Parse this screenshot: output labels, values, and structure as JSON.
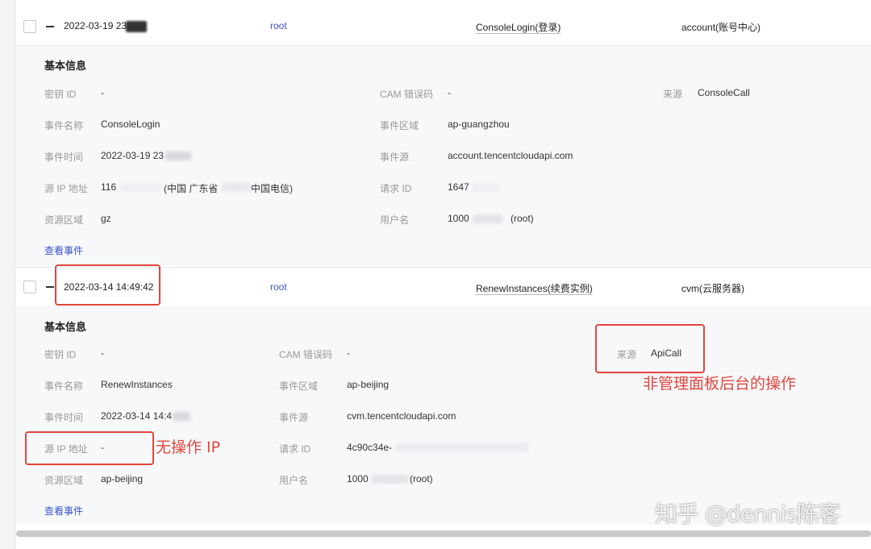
{
  "colors": {
    "link": "#3b55c8",
    "annotation": "#e0463d"
  },
  "events": [
    {
      "time": "2022-03-19 23",
      "user": "root",
      "event_name": "ConsoleLogin(登录)",
      "service": "account(账号中心)",
      "detail": {
        "title": "基本信息",
        "secret_id_label": "密钥 ID",
        "secret_id": "-",
        "cam_label": "CAM 错误码",
        "cam": "-",
        "source_label": "来源",
        "source": "ConsoleCall",
        "name_label": "事件名称",
        "name": "ConsoleLogin",
        "region_label": "事件区域",
        "region": "ap-guangzhou",
        "time_label": "事件时间",
        "time": "2022-03-19 23",
        "event_source_label": "事件源",
        "event_source": "account.tencentcloudapi.com",
        "ip_label": "源 IP 地址",
        "ip": "116",
        "ip_geo_a": "(中国 广东省",
        "ip_geo_b": "中国电信)",
        "request_label": "请求 ID",
        "request": "1647",
        "res_region_label": "资源区域",
        "res_region": "gz",
        "username_label": "用户名",
        "username": "1000",
        "username_suffix": "(root)",
        "view_link": "查看事件"
      }
    },
    {
      "time": "2022-03-14 14:49:42",
      "user": "root",
      "event_name": "RenewInstances(续费实例)",
      "service": "cvm(云服务器)",
      "detail": {
        "title": "基本信息",
        "secret_id_label": "密钥 ID",
        "secret_id": "-",
        "cam_label": "CAM 错误码",
        "cam": "-",
        "source_label": "来源",
        "source": "ApiCall",
        "name_label": "事件名称",
        "name": "RenewInstances",
        "region_label": "事件区域",
        "region": "ap-beijing",
        "time_label": "事件时间",
        "time": "2022-03-14 14:4",
        "event_source_label": "事件源",
        "event_source": "cvm.tencentcloudapi.com",
        "ip_label": "源 IP 地址",
        "ip": "-",
        "request_label": "请求 ID",
        "request": "4c90c34e-",
        "res_region_label": "资源区域",
        "res_region": "ap-beijing",
        "username_label": "用户名",
        "username": "1000",
        "username_suffix": "(root)",
        "view_link": "查看事件"
      }
    }
  ],
  "annotations": {
    "source_note": "非管理面板后台的操作",
    "ip_note": "无操作 IP"
  },
  "watermark": "知乎 @dennis陈客"
}
